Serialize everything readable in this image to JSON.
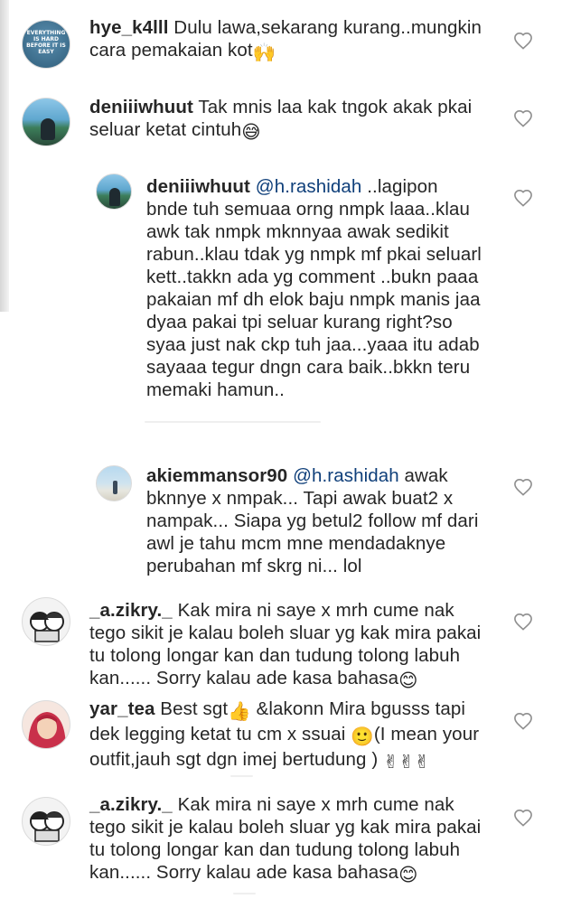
{
  "comments": [
    {
      "username": "hye_k4lll",
      "body": " Dulu lawa,sekarang kurang..mungkin\ncara pemakaian kot",
      "emoji": "🙌",
      "avatar_text": "EVERYTHING IS HARD BEFORE IT IS EASY"
    },
    {
      "username": "deniiiwhuut",
      "body": " Tak mnis laa kak tngok akak pkai\nseluar ketat cintuh",
      "emoji": "😅"
    },
    {
      "username": "deniiiwhuut",
      "mention": "@h.rashidah",
      "body": " ..lagipon\nbnde tuh semuaa orng nmpk laaa..klau\nawk tak nmpk mknnyaa awak sedikit\nrabun..klau tdak yg nmpk mf pkai seluarl\nkett..takkn ada yg comment ..bukn paaa\npakaian mf dh elok baju nmpk manis jaa\ndyaa pakai tpi seluar kurang right?so\nsyaa just nak ckp tuh jaa...yaaa itu adab\nsayaaa tegur dngn cara baik..bkkn teru\nmemaki hamun.."
    },
    {
      "username": "akiemmansor90",
      "mention": "@h.rashidah",
      "body": " awak\nbknnye x nmpak... Tapi awak buat2 x\nnampak... Siapa yg betul2 follow mf dari\nawl je tahu mcm mne mendadaknye\nperubahan mf skrg ni... lol"
    },
    {
      "username": "_a.zikry._",
      "body": " Kak mira ni saye x mrh cume nak\ntego sikit je kalau boleh sluar yg kak mira pakai\ntu tolong longar kan dan tudung tolong labuh\nkan...... Sorry kalau ade kasa bahasa",
      "emoji": "😊"
    },
    {
      "username": "yar_tea",
      "body_parts": [
        " Best sgt",
        "👍",
        " &lakonn Mira bgusss tapi\ndek legging ketat tu cm x ssuai ",
        "🙂",
        "(I mean your\noutfit,jauh sgt dgn imej bertudung ) ",
        "✌✌✌"
      ]
    },
    {
      "username": "_a.zikry._",
      "body": " Kak mira ni saye x mrh cume nak\ntego sikit je kalau boleh sluar yg kak mira pakai\ntu tolong longar kan dan tudung tolong labuh\nkan...... Sorry kalau ade kasa bahasa",
      "emoji": "😊"
    }
  ],
  "icons": {
    "like": "heart-outline-icon"
  },
  "colors": {
    "text": "#262626",
    "mention": "#0f3f7a",
    "heart": "#8e8e8e"
  }
}
